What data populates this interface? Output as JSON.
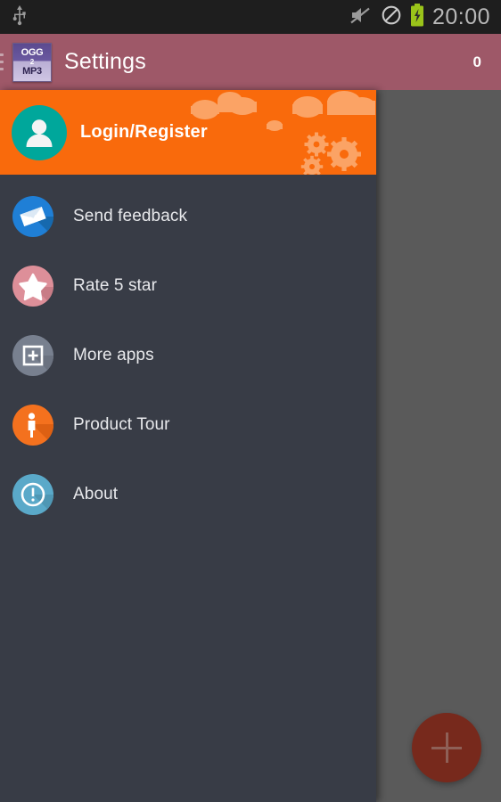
{
  "statusbar": {
    "usb_icon": "usb-icon",
    "mute_icon": "volume-muted-icon",
    "dnd_icon": "do-not-disturb-icon",
    "battery_icon": "battery-charging-icon",
    "time": "20:00"
  },
  "actionbar": {
    "menu_icon": "hamburger-menu-icon",
    "app_icon": {
      "line1": "OGG",
      "line2": "2",
      "line3": "MP3",
      "name": "ogg2mp3-app-icon"
    },
    "title": "Settings",
    "counter": "0"
  },
  "drawer": {
    "header": {
      "avatar_icon": "person-avatar-icon",
      "title": "Login/Register",
      "background_color": "#f96a0c",
      "avatar_color": "#00a79b",
      "decoration": "clouds-and-gears"
    },
    "items": [
      {
        "label": "Send feedback",
        "icon": "envelope-icon",
        "color": "#1f7fd6",
        "name": "send-feedback"
      },
      {
        "label": "Rate 5 star",
        "icon": "star-icon",
        "color": "#dd8f99",
        "name": "rate-5-star"
      },
      {
        "label": "More apps",
        "icon": "plus-square-icon",
        "color": "#78808f",
        "name": "more-apps"
      },
      {
        "label": "Product Tour",
        "icon": "person-standing-icon",
        "color": "#f4711e",
        "name": "product-tour"
      },
      {
        "label": "About",
        "icon": "exclamation-circle-icon",
        "color": "#5aa9c9",
        "name": "about"
      }
    ]
  },
  "content": {
    "scrim_color": "#5a5a5a",
    "fab": {
      "icon": "plus-icon",
      "label": "Add",
      "color": "#77291c"
    }
  }
}
